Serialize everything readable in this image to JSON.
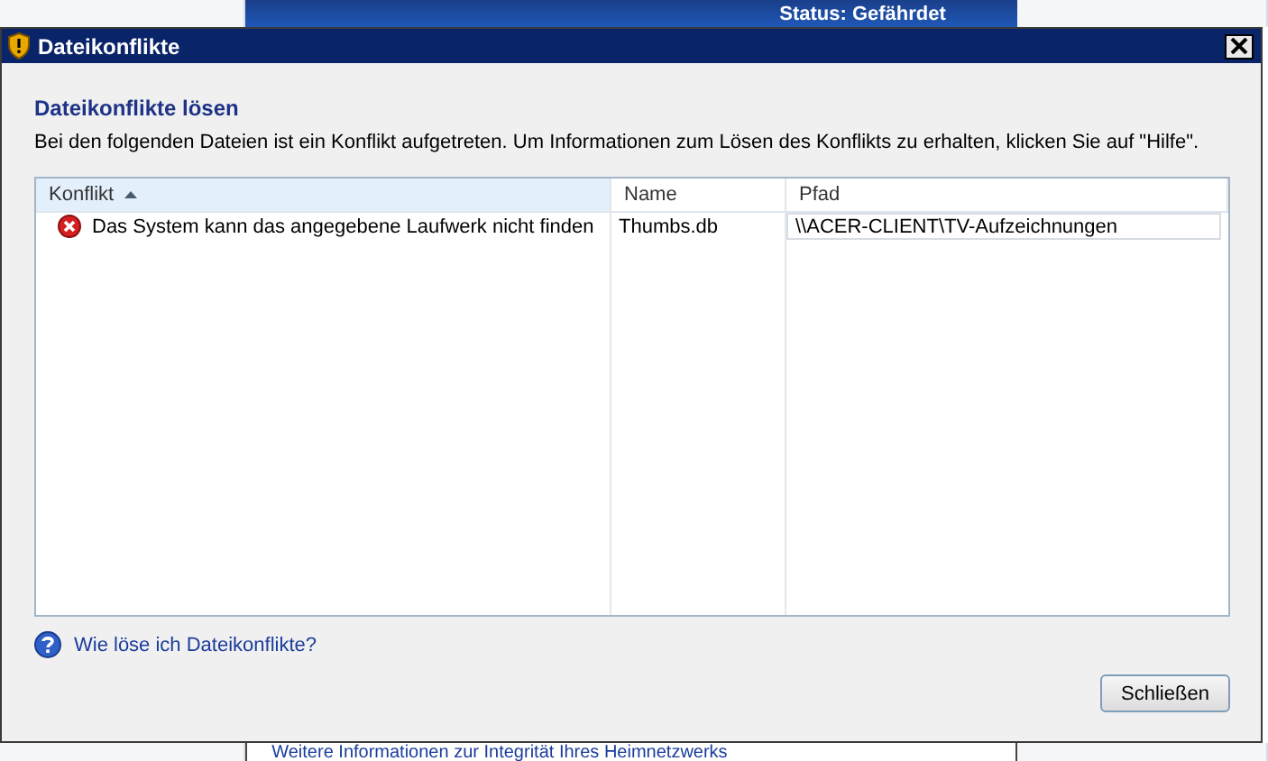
{
  "background": {
    "status": "Status: Gefährdet",
    "link": "Weitere Informationen zur Integrität Ihres Heimnetzwerks"
  },
  "window": {
    "title": "Dateikonflikte"
  },
  "heading": "Dateikonflikte lösen",
  "description": "Bei den folgenden Dateien ist ein Konflikt aufgetreten. Um Informationen zum Lösen des Konflikts zu erhalten, klicken Sie auf \"Hilfe\".",
  "table": {
    "columns": [
      {
        "label": "Konflikt",
        "sorted": true
      },
      {
        "label": "Name",
        "sorted": false
      },
      {
        "label": "Pfad",
        "sorted": false
      }
    ],
    "rows": [
      {
        "conflict": "Das System kann das angegebene Laufwerk nicht finden",
        "name": "Thumbs.db",
        "path": "\\\\ACER-CLIENT\\TV-Aufzeichnungen"
      }
    ]
  },
  "help_link": "Wie löse ich Dateikonflikte?",
  "buttons": [
    "Schließen"
  ]
}
